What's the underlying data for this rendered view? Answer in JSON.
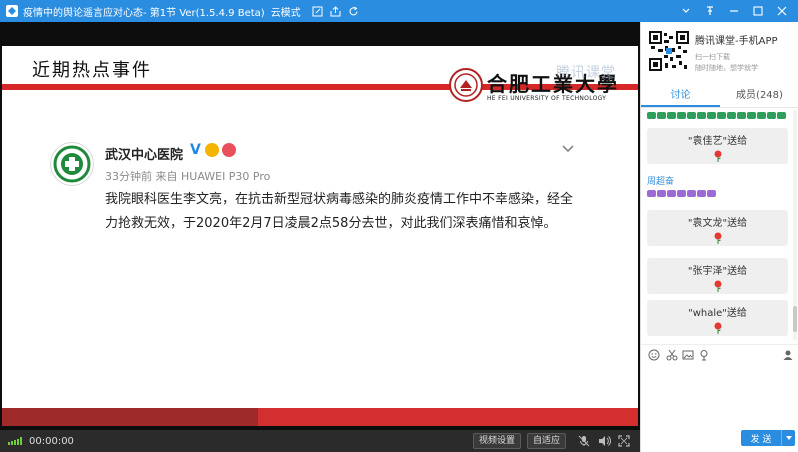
{
  "window": {
    "title": "疫情中的舆论遥言应对心态- 第1节 Ver(1.5.4.9 Beta)",
    "mode": "云模式",
    "colors": {
      "titlebar": "#2a8de0",
      "accent": "#2a8de0"
    }
  },
  "slide": {
    "title": "近期热点事件",
    "university_name": "合肥工業大學",
    "university_en": "HE FEI UNIVERSITY OF TECHNOLOGY",
    "watermark": "腾讯课堂",
    "post": {
      "author": "武汉中心医院",
      "verified_mark": "V",
      "meta": "33分钟前 来自 HUAWEI P30 Pro",
      "body": "我院眼科医生李文亮，在抗击新型冠状病毒感染的肺炎疫情工作中不幸感染，经全力抢救无效，于2020年2月7日凌晨2点58分去世，对此我们深表痛惜和哀悼。"
    }
  },
  "controls": {
    "time": "00:00:00",
    "video_settings": "视频设置",
    "auto_fit": "自适应"
  },
  "panel": {
    "promo_title": "腾讯课堂-手机APP",
    "promo_line1": "扫一扫下载",
    "promo_line2": "随时随地，想学就学",
    "tab_discussion": "讨论",
    "tab_members": "成员(248)",
    "messages": [
      {
        "type": "gift",
        "text": "\"袁佳艺\"送给"
      },
      {
        "type": "sender",
        "text": "周超奋"
      },
      {
        "type": "gift",
        "text": "\"袁文龙\"送给"
      },
      {
        "type": "gift",
        "text": "\"张宇泽\"送给"
      },
      {
        "type": "gift",
        "text": "\"whale\"送给"
      }
    ],
    "send_label": "发 送"
  }
}
